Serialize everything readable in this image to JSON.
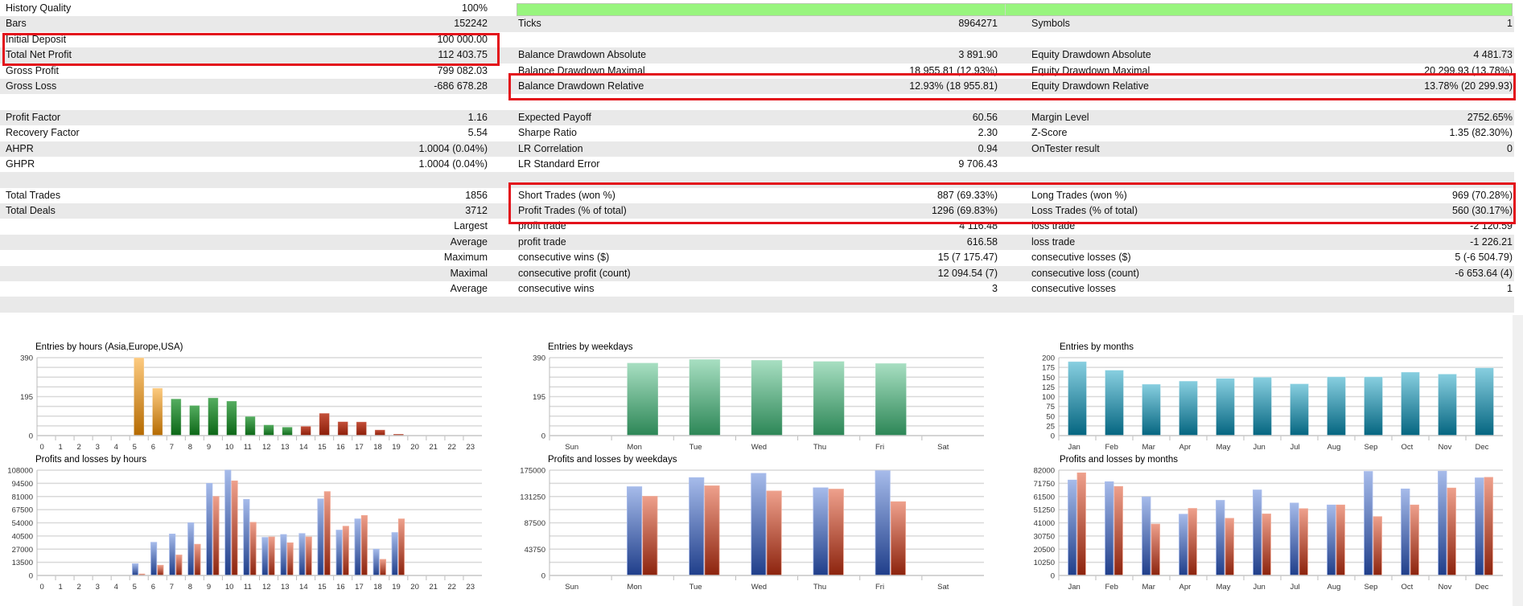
{
  "history_quality": {
    "label": "History Quality",
    "value": "100%",
    "progress_percent": 100,
    "bar_color": "#98f57e"
  },
  "rows": [
    {
      "l1": "Bars",
      "v1": "152242",
      "l2": "Ticks",
      "v2": "8964271",
      "l3": "Symbols",
      "v3": "1"
    },
    {
      "l1": "Initial Deposit",
      "v1": "100 000.00",
      "l2": "",
      "v2": "",
      "l3": "",
      "v3": ""
    },
    {
      "l1": "Total Net Profit",
      "v1": "112 403.75",
      "l2": "Balance Drawdown Absolute",
      "v2": "3 891.90",
      "l3": "Equity Drawdown Absolute",
      "v3": "4 481.73"
    },
    {
      "l1": "Gross Profit",
      "v1": "799 082.03",
      "l2": "Balance Drawdown Maximal",
      "v2": "18 955.81 (12.93%)",
      "l3": "Equity Drawdown Maximal",
      "v3": "20 299.93 (13.78%)"
    },
    {
      "l1": "Gross Loss",
      "v1": "-686 678.28",
      "l2": "Balance Drawdown Relative",
      "v2": "12.93% (18 955.81)",
      "l3": "Equity Drawdown Relative",
      "v3": "13.78% (20 299.93)"
    },
    {
      "l1": "",
      "v1": "",
      "l2": "",
      "v2": "",
      "l3": "",
      "v3": ""
    },
    {
      "l1": "Profit Factor",
      "v1": "1.16",
      "l2": "Expected Payoff",
      "v2": "60.56",
      "l3": "Margin Level",
      "v3": "2752.65%"
    },
    {
      "l1": "Recovery Factor",
      "v1": "5.54",
      "l2": "Sharpe Ratio",
      "v2": "2.30",
      "l3": "Z-Score",
      "v3": "1.35 (82.30%)"
    },
    {
      "l1": "AHPR",
      "v1": "1.0004 (0.04%)",
      "l2": "LR Correlation",
      "v2": "0.94",
      "l3": "OnTester result",
      "v3": "0"
    },
    {
      "l1": "GHPR",
      "v1": "1.0004 (0.04%)",
      "l2": "LR Standard Error",
      "v2": "9 706.43",
      "l3": "",
      "v3": ""
    },
    {
      "l1": "",
      "v1": "",
      "l2": "",
      "v2": "",
      "l3": "",
      "v3": ""
    },
    {
      "l1": "Total Trades",
      "v1": "1856",
      "l2": "Short Trades (won %)",
      "v2": "887 (69.33%)",
      "l3": "Long Trades (won %)",
      "v3": "969 (70.28%)"
    },
    {
      "l1": "Total Deals",
      "v1": "3712",
      "l2": "Profit Trades (% of total)",
      "v2": "1296 (69.83%)",
      "l3": "Loss Trades (% of total)",
      "v3": "560 (30.17%)"
    },
    {
      "l1": "",
      "v1": "Largest",
      "l2": "profit trade",
      "v2": "4 116.48",
      "l3": "loss trade",
      "v3": "-2 120.59"
    },
    {
      "l1": "",
      "v1": "Average",
      "l2": "profit trade",
      "v2": "616.58",
      "l3": "loss trade",
      "v3": "-1 226.21"
    },
    {
      "l1": "",
      "v1": "Maximum",
      "l2": "consecutive wins ($)",
      "v2": "15 (7 175.47)",
      "l3": "consecutive losses ($)",
      "v3": "5 (-6 504.79)"
    },
    {
      "l1": "",
      "v1": "Maximal",
      "l2": "consecutive profit (count)",
      "v2": "12 094.54 (7)",
      "l3": "consecutive loss (count)",
      "v3": "-6 653.64 (4)"
    },
    {
      "l1": "",
      "v1": "Average",
      "l2": "consecutive wins",
      "v2": "3",
      "l3": "consecutive losses",
      "v3": "1"
    },
    {
      "l1": "",
      "v1": "",
      "l2": "",
      "v2": "",
      "l3": "",
      "v3": ""
    }
  ],
  "highlight_color": "#e3121b",
  "chart_data": [
    {
      "type": "bar",
      "title": "Entries by hours (Asia,Europe,USA)",
      "categories": [
        "0",
        "1",
        "2",
        "3",
        "4",
        "5",
        "6",
        "7",
        "8",
        "9",
        "10",
        "11",
        "12",
        "13",
        "14",
        "15",
        "16",
        "17",
        "18",
        "19",
        "20",
        "21",
        "22",
        "23"
      ],
      "values": [
        0,
        0,
        0,
        0,
        0,
        390,
        238,
        184,
        151,
        189,
        173,
        96,
        54,
        43,
        47,
        112,
        70,
        69,
        29,
        8,
        0,
        0,
        0,
        0
      ],
      "bar_colors": [
        "orange",
        "orange",
        "orange",
        "orange",
        "orange",
        "orange",
        "orange",
        "green",
        "green",
        "green",
        "green",
        "green",
        "green",
        "green",
        "red",
        "red",
        "red",
        "red",
        "red",
        "red",
        "red",
        "red",
        "red",
        "red"
      ],
      "ylim": [
        0,
        390
      ],
      "yticks": [
        0,
        195,
        390
      ],
      "grid_step": 48.75,
      "grid": true
    },
    {
      "type": "bar",
      "title": "Entries by weekdays",
      "categories": [
        "Sun",
        "Mon",
        "Tue",
        "Wed",
        "Thu",
        "Fri",
        "Sat"
      ],
      "values": [
        0,
        364,
        382,
        378,
        372,
        362,
        0
      ],
      "ylim": [
        0,
        390
      ],
      "yticks": [
        0,
        195,
        390
      ],
      "grid_step": 48.75,
      "grid": true,
      "color": "weekgreen"
    },
    {
      "type": "bar",
      "title": "Entries by months",
      "categories": [
        "Jan",
        "Feb",
        "Mar",
        "Apr",
        "May",
        "Jun",
        "Jul",
        "Aug",
        "Sep",
        "Oct",
        "Nov",
        "Dec"
      ],
      "values": [
        190,
        168,
        132,
        140,
        147,
        150,
        133,
        151,
        151,
        163,
        158,
        174
      ],
      "ylim": [
        0,
        200
      ],
      "yticks": [
        0,
        25,
        50,
        75,
        100,
        125,
        150,
        175,
        200
      ],
      "grid_step": 25,
      "grid": true,
      "color": "teal"
    },
    {
      "type": "bar",
      "title": "Profits and losses by hours",
      "categories": [
        "0",
        "1",
        "2",
        "3",
        "4",
        "5",
        "6",
        "7",
        "8",
        "9",
        "10",
        "11",
        "12",
        "13",
        "14",
        "15",
        "16",
        "17",
        "18",
        "19",
        "20",
        "21",
        "22",
        "23"
      ],
      "series": [
        {
          "values": [
            0,
            0,
            0,
            0,
            0,
            12000,
            34000,
            42500,
            54000,
            94500,
            108000,
            78000,
            39000,
            42000,
            43000,
            78500,
            46500,
            58000,
            27000,
            44000,
            0,
            0,
            0,
            0
          ],
          "color": "blue"
        },
        {
          "values": [
            0,
            0,
            0,
            0,
            0,
            1500,
            10500,
            21000,
            32000,
            81000,
            97000,
            54500,
            39500,
            33500,
            39500,
            86000,
            50500,
            61500,
            16500,
            58000,
            0,
            0,
            0,
            0
          ],
          "color": "salmon"
        }
      ],
      "ylim": [
        0,
        108000
      ],
      "yticks": [
        0,
        13500,
        27000,
        40500,
        54000,
        67500,
        81000,
        94500,
        108000
      ],
      "grid_step": 13500,
      "grid": true
    },
    {
      "type": "bar",
      "title": "Profits and losses by weekdays",
      "categories": [
        "Sun",
        "Mon",
        "Tue",
        "Wed",
        "Thu",
        "Fri",
        "Sat"
      ],
      "series": [
        {
          "values": [
            0,
            147500,
            162600,
            169700,
            145700,
            174100,
            0
          ],
          "color": "blue"
        },
        {
          "values": [
            0,
            131500,
            149000,
            140400,
            143500,
            122600,
            0
          ],
          "color": "salmon"
        }
      ],
      "ylim": [
        0,
        175000
      ],
      "yticks": [
        0,
        43750,
        87500,
        131250,
        175000
      ],
      "grid_step": 21875,
      "grid": true
    },
    {
      "type": "bar",
      "title": "Profits and losses by months",
      "categories": [
        "Jan",
        "Feb",
        "Mar",
        "Apr",
        "May",
        "Jun",
        "Jul",
        "Aug",
        "Sep",
        "Oct",
        "Nov",
        "Dec"
      ],
      "series": [
        {
          "values": [
            74300,
            73000,
            61200,
            47700,
            58500,
            66600,
            56400,
            54900,
            81000,
            67400,
            81200,
            76000
          ],
          "color": "blue"
        },
        {
          "values": [
            79900,
            69300,
            40000,
            52200,
            44500,
            47900,
            52000,
            54900,
            45800,
            54900,
            68100,
            76400
          ],
          "color": "salmon"
        }
      ],
      "ylim": [
        0,
        82000
      ],
      "yticks": [
        0,
        10250,
        20500,
        30750,
        41000,
        51250,
        61500,
        71750,
        82000
      ],
      "grid_step": 10250,
      "grid": true
    }
  ]
}
